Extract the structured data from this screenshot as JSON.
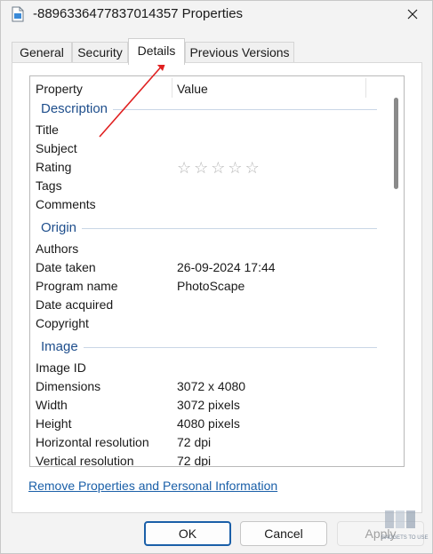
{
  "window": {
    "title": "-8896336477837014357 Properties"
  },
  "tabs": [
    {
      "label": "General"
    },
    {
      "label": "Security"
    },
    {
      "label": "Details",
      "active": true
    },
    {
      "label": "Previous Versions"
    }
  ],
  "listview": {
    "columns": {
      "property": "Property",
      "value": "Value"
    },
    "groups": {
      "description": "Description",
      "origin": "Origin",
      "image": "Image"
    },
    "rows": {
      "title": {
        "p": "Title",
        "v": ""
      },
      "subject": {
        "p": "Subject",
        "v": ""
      },
      "rating": {
        "p": "Rating",
        "stars": 0,
        "max": 5
      },
      "tags": {
        "p": "Tags",
        "v": ""
      },
      "comments": {
        "p": "Comments",
        "v": ""
      },
      "authors": {
        "p": "Authors",
        "v": ""
      },
      "date_taken": {
        "p": "Date taken",
        "v": "26-09-2024 17:44"
      },
      "program_name": {
        "p": "Program name",
        "v": "PhotoScape"
      },
      "date_acquired": {
        "p": "Date acquired",
        "v": ""
      },
      "copyright": {
        "p": "Copyright",
        "v": ""
      },
      "image_id": {
        "p": "Image ID",
        "v": ""
      },
      "dimensions": {
        "p": "Dimensions",
        "v": "3072 x 4080"
      },
      "width": {
        "p": "Width",
        "v": "3072 pixels"
      },
      "height": {
        "p": "Height",
        "v": "4080 pixels"
      },
      "hres": {
        "p": "Horizontal resolution",
        "v": "72 dpi"
      },
      "vres": {
        "p": "Vertical resolution",
        "v": "72 dpi"
      }
    }
  },
  "link": {
    "remove": "Remove Properties and Personal Information"
  },
  "buttons": {
    "ok": "OK",
    "cancel": "Cancel",
    "apply": "Apply"
  },
  "colors": {
    "accent": "#1a5fa8",
    "group_header": "#1e4e8c",
    "annotation_arrow": "#e02020"
  },
  "watermark": {
    "text": "GADGETS TO USE"
  }
}
